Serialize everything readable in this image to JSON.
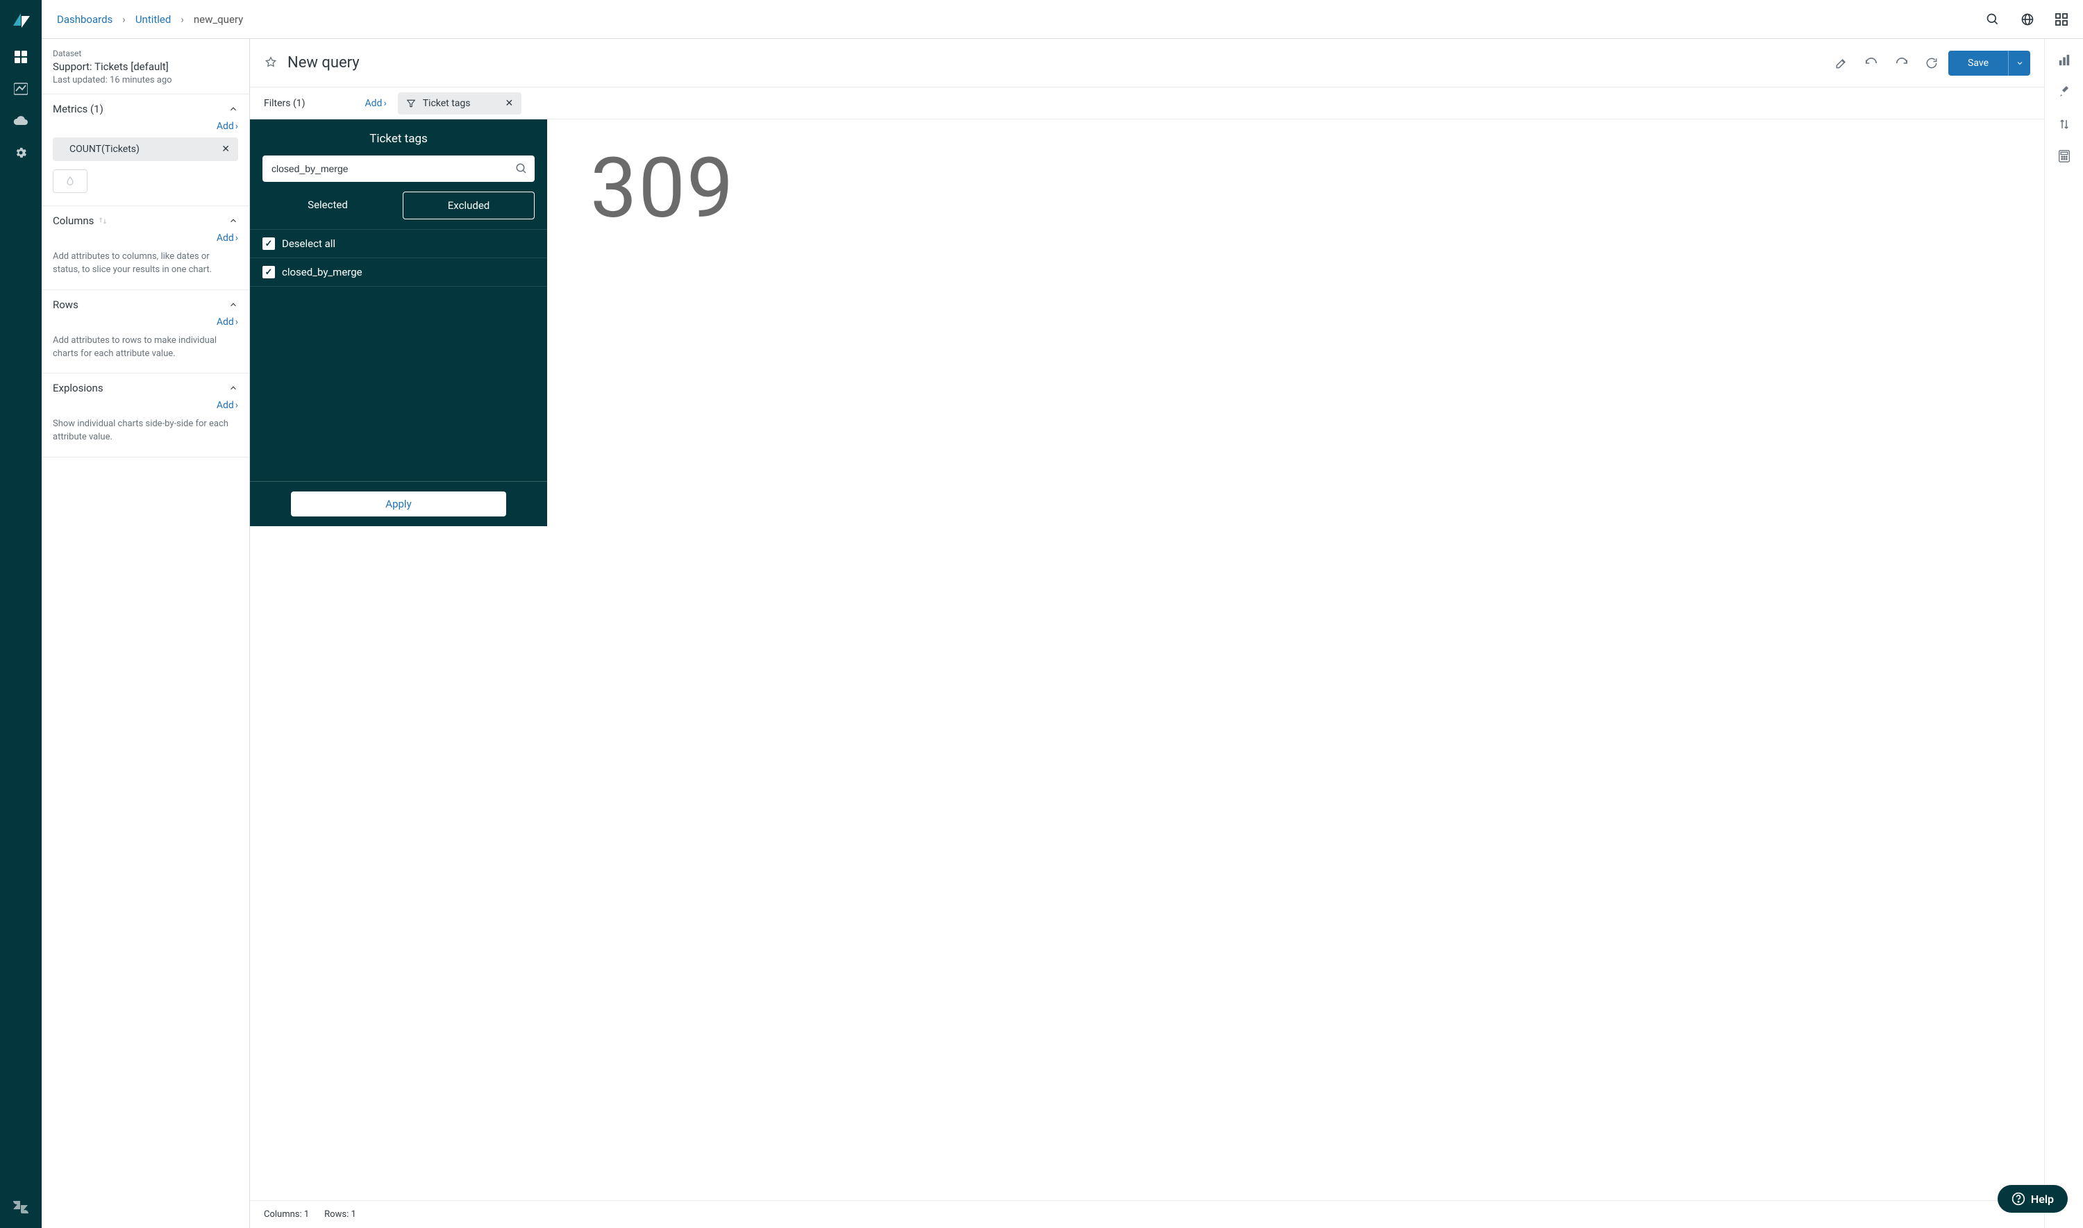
{
  "breadcrumb": {
    "dashboards": "Dashboards",
    "untitled": "Untitled",
    "current": "new_query"
  },
  "dataset": {
    "label": "Dataset",
    "name": "Support: Tickets [default]",
    "updated": "Last updated: 16 minutes ago"
  },
  "sections": {
    "metrics": {
      "title": "Metrics (1)",
      "add": "Add",
      "item": "COUNT(Tickets)"
    },
    "columns": {
      "title": "Columns",
      "add": "Add",
      "help": "Add attributes to columns, like dates or status, to slice your results in one chart."
    },
    "rows": {
      "title": "Rows",
      "add": "Add",
      "help": "Add attributes to rows to make individual charts for each attribute value."
    },
    "explosions": {
      "title": "Explosions",
      "add": "Add",
      "help": "Show individual charts side-by-side for each attribute value."
    }
  },
  "query": {
    "title": "New query",
    "save": "Save"
  },
  "filters": {
    "label": "Filters (1)",
    "add": "Add",
    "chip": "Ticket tags"
  },
  "popover": {
    "title": "Ticket tags",
    "search_value": "closed_by_merge",
    "tab_selected": "Selected",
    "tab_excluded": "Excluded",
    "deselect": "Deselect all",
    "option1": "closed_by_merge",
    "apply": "Apply"
  },
  "result": {
    "value": "309"
  },
  "status": {
    "columns": "Columns: 1",
    "rows": "Rows: 1"
  },
  "help": {
    "label": "Help"
  }
}
